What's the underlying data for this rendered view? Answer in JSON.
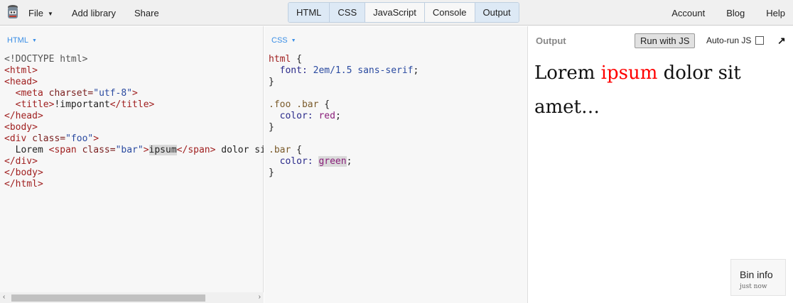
{
  "topbar": {
    "file": "File",
    "add_library": "Add library",
    "share": "Share",
    "tabs": [
      {
        "label": "HTML",
        "active": true
      },
      {
        "label": "CSS",
        "active": true
      },
      {
        "label": "JavaScript",
        "active": false
      },
      {
        "label": "Console",
        "active": false
      },
      {
        "label": "Output",
        "active": true
      }
    ],
    "account": "Account",
    "blog": "Blog",
    "help": "Help"
  },
  "html_panel": {
    "label": "HTML",
    "code": {
      "l1": "<!DOCTYPE html>",
      "l2": "<html>",
      "l3": "<head>",
      "l4_tag_open": "  <meta ",
      "l4_attr": "charset=",
      "l4_val": "\"utf-8\"",
      "l4_close": ">",
      "l5_open": "  <title>",
      "l5_text": "!important",
      "l5_close": "</title>",
      "l6": "</head>",
      "l7": "<body>",
      "l8_open": "<div ",
      "l8_attr": "class=",
      "l8_val": "\"foo\"",
      "l8_close": ">",
      "l9_text1": "  Lorem ",
      "l9_span_open": "<span ",
      "l9_attr": "class=",
      "l9_val": "\"bar\"",
      "l9_close": ">",
      "l9_hl": "ipsum",
      "l9_span_close": "</span>",
      "l9_text2": " dolor sit amet",
      "l10": "</div>",
      "l11": "</body>",
      "l12": "</html>"
    }
  },
  "css_panel": {
    "label": "CSS",
    "code": {
      "r1_sel": "html",
      "r1_brace": " {",
      "r1_prop": "  font: ",
      "r1_val": "2em/1.5 sans-serif",
      "r1_semi": ";",
      "r1_end": "}",
      "r2_sel": ".foo .bar",
      "r2_brace": " {",
      "r2_prop": "  color: ",
      "r2_val": "red",
      "r2_semi": ";",
      "r2_end": "}",
      "r3_sel": ".bar",
      "r3_brace": " {",
      "r3_prop": "  color: ",
      "r3_val": "green",
      "r3_semi": ";",
      "r3_end": "}"
    }
  },
  "output_panel": {
    "label": "Output",
    "run_button": "Run with JS",
    "autorun_label": "Auto-run JS",
    "autorun_checked": false,
    "content": {
      "text1": "Lorem ",
      "red": "ipsum",
      "text2": " dolor sit amet…"
    },
    "bin_info": {
      "title": "Bin info",
      "subtitle": "just now"
    }
  },
  "icons": {
    "logo": "jsbin-logo-icon",
    "caret": "caret-down-icon",
    "expand": "expand-arrow-icon",
    "scroll_left": "scroll-left-arrow-icon",
    "scroll_right": "scroll-right-arrow-icon"
  },
  "colors": {
    "tab_active_bg": "#dde9f5",
    "panel_label": "#3a8ee6",
    "ipsum_output": "#ff0000"
  }
}
